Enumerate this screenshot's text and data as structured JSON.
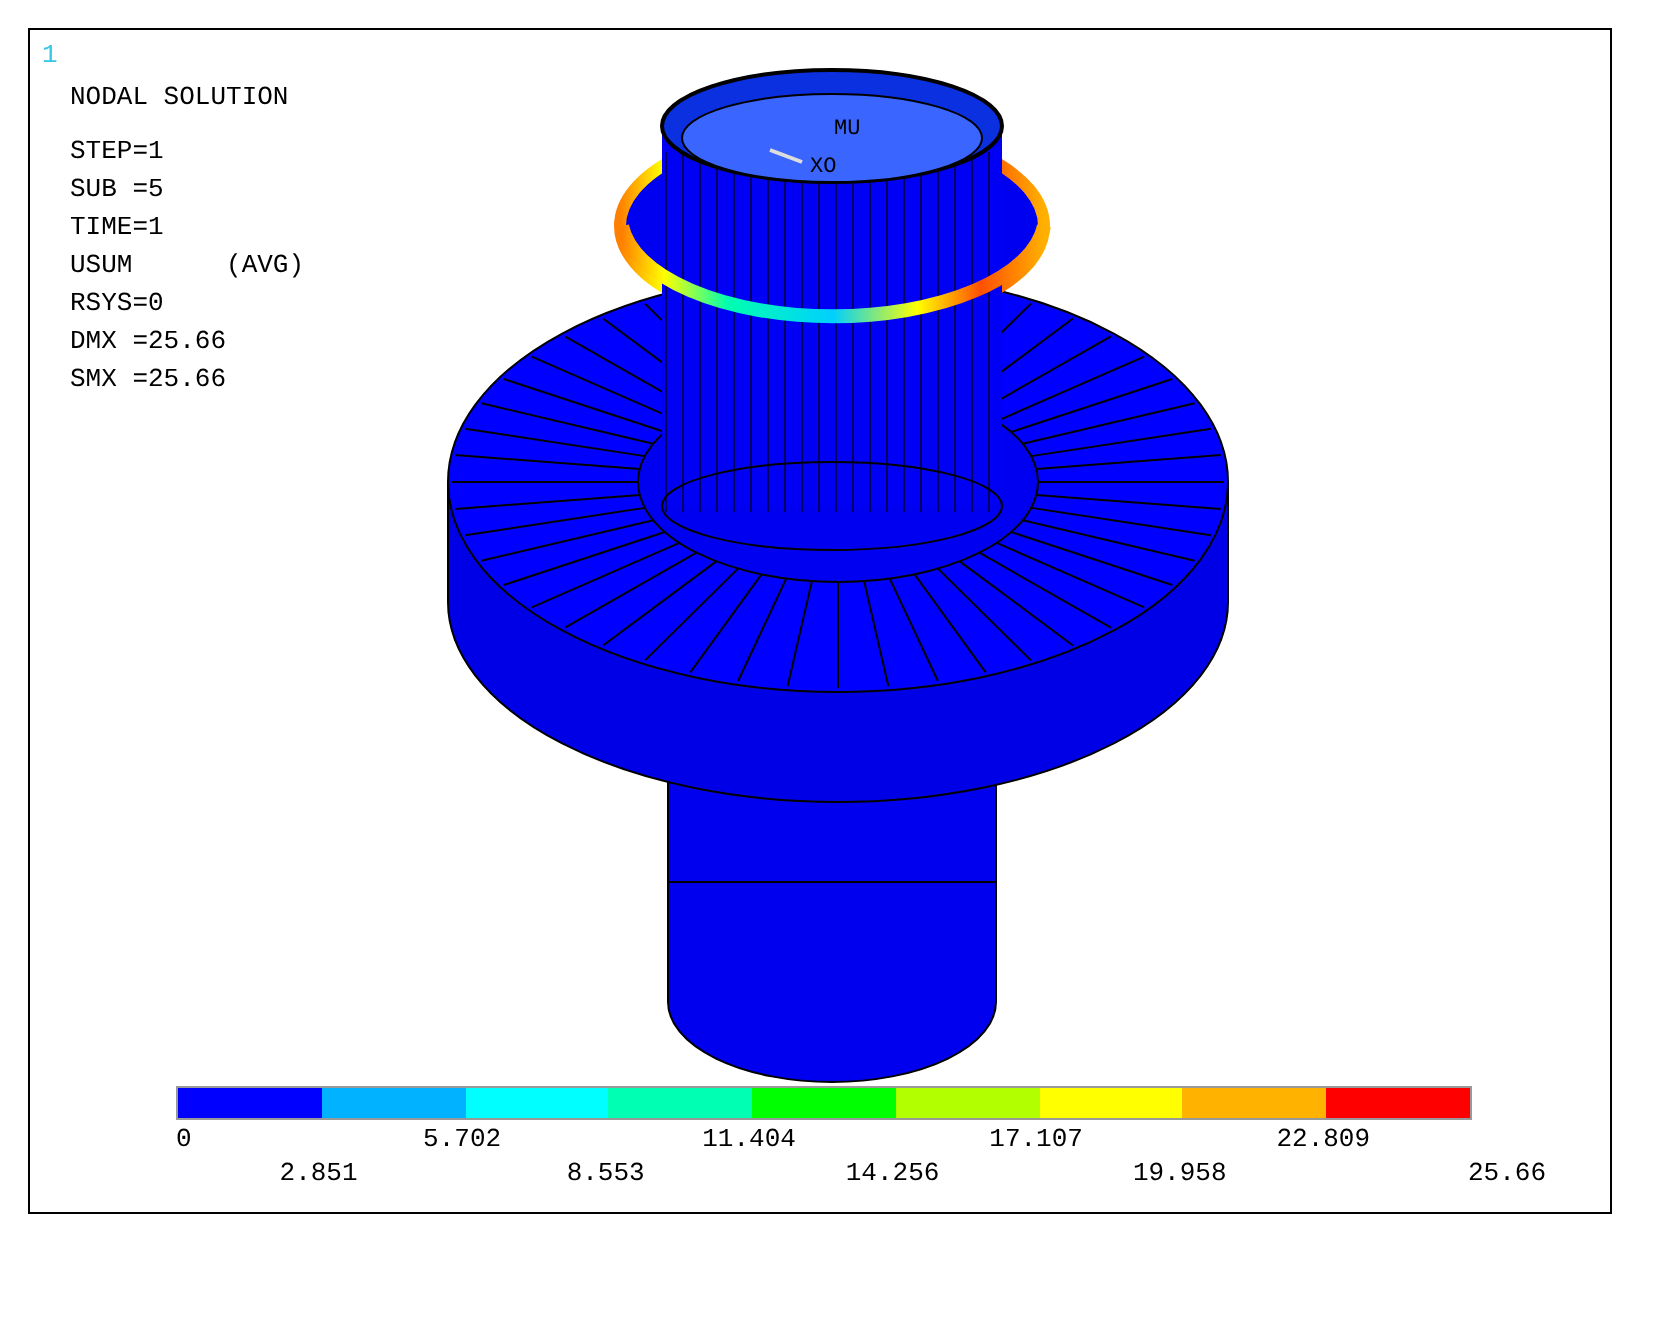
{
  "window_number": "1",
  "title": "NODAL SOLUTION",
  "info_lines": [
    "STEP=1",
    "SUB =5",
    "TIME=1",
    "USUM      (AVG)",
    "RSYS=0",
    "DMX =25.66",
    "SMX =25.66"
  ],
  "axis_labels": [
    "MU",
    "XO"
  ],
  "legend": {
    "bands": [
      {
        "color": "#0000ff"
      },
      {
        "color": "#00b2ff"
      },
      {
        "color": "#00ffff"
      },
      {
        "color": "#00ffb2"
      },
      {
        "color": "#00ff00"
      },
      {
        "color": "#b2ff00"
      },
      {
        "color": "#ffff00"
      },
      {
        "color": "#ffb200"
      },
      {
        "color": "#ff0000"
      }
    ],
    "labels": [
      "0",
      "2.851",
      "5.702",
      "8.553",
      "11.404",
      "14.256",
      "17.107",
      "19.958",
      "22.809",
      "25.66"
    ]
  }
}
